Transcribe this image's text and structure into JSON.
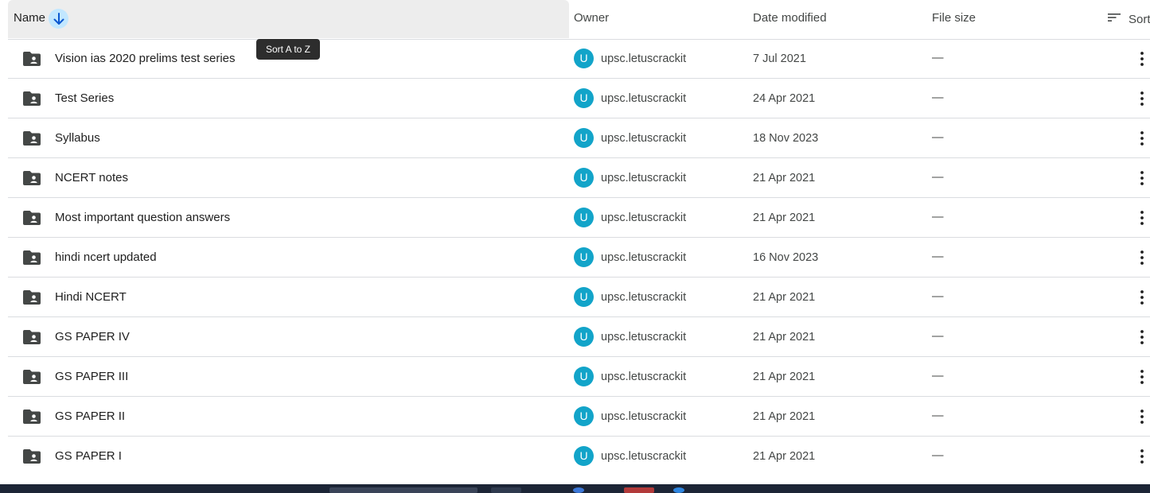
{
  "colors": {
    "accent": "#0b57d0",
    "avatar_bg": "#12a4c9",
    "header_bg": "#ededed",
    "sort_icon_bg": "#c2e7ff",
    "taskbar_bg": "#1c2536"
  },
  "header": {
    "name_label": "Name",
    "sort_direction_icon": "arrow-down-icon",
    "owner_label": "Owner",
    "date_label": "Date modified",
    "size_label": "File size",
    "sort_label": "Sort",
    "sort_icon": "sort-lines-icon"
  },
  "tooltip": {
    "text": "Sort A to Z"
  },
  "rows": [
    {
      "name": "Vision ias 2020 prelims test series",
      "avatar": "U",
      "owner": "upsc.letuscrackit",
      "date": "7 Jul 2021",
      "size": "—"
    },
    {
      "name": "Test Series",
      "avatar": "U",
      "owner": "upsc.letuscrackit",
      "date": "24 Apr 2021",
      "size": "—"
    },
    {
      "name": "Syllabus",
      "avatar": "U",
      "owner": "upsc.letuscrackit",
      "date": "18 Nov 2023",
      "size": "—"
    },
    {
      "name": "NCERT notes",
      "avatar": "U",
      "owner": "upsc.letuscrackit",
      "date": "21 Apr 2021",
      "size": "—"
    },
    {
      "name": "Most important question answers",
      "avatar": "U",
      "owner": "upsc.letuscrackit",
      "date": "21 Apr 2021",
      "size": "—"
    },
    {
      "name": "hindi ncert updated",
      "avatar": "U",
      "owner": "upsc.letuscrackit",
      "date": "16 Nov 2023",
      "size": "—"
    },
    {
      "name": "Hindi NCERT",
      "avatar": "U",
      "owner": "upsc.letuscrackit",
      "date": "21 Apr 2021",
      "size": "—"
    },
    {
      "name": "GS PAPER IV",
      "avatar": "U",
      "owner": "upsc.letuscrackit",
      "date": "21 Apr 2021",
      "size": "—"
    },
    {
      "name": "GS PAPER III",
      "avatar": "U",
      "owner": "upsc.letuscrackit",
      "date": "21 Apr 2021",
      "size": "—"
    },
    {
      "name": "GS PAPER II",
      "avatar": "U",
      "owner": "upsc.letuscrackit",
      "date": "21 Apr 2021",
      "size": "—"
    },
    {
      "name": "GS PAPER I",
      "avatar": "U",
      "owner": "upsc.letuscrackit",
      "date": "21 Apr 2021",
      "size": "—"
    }
  ]
}
